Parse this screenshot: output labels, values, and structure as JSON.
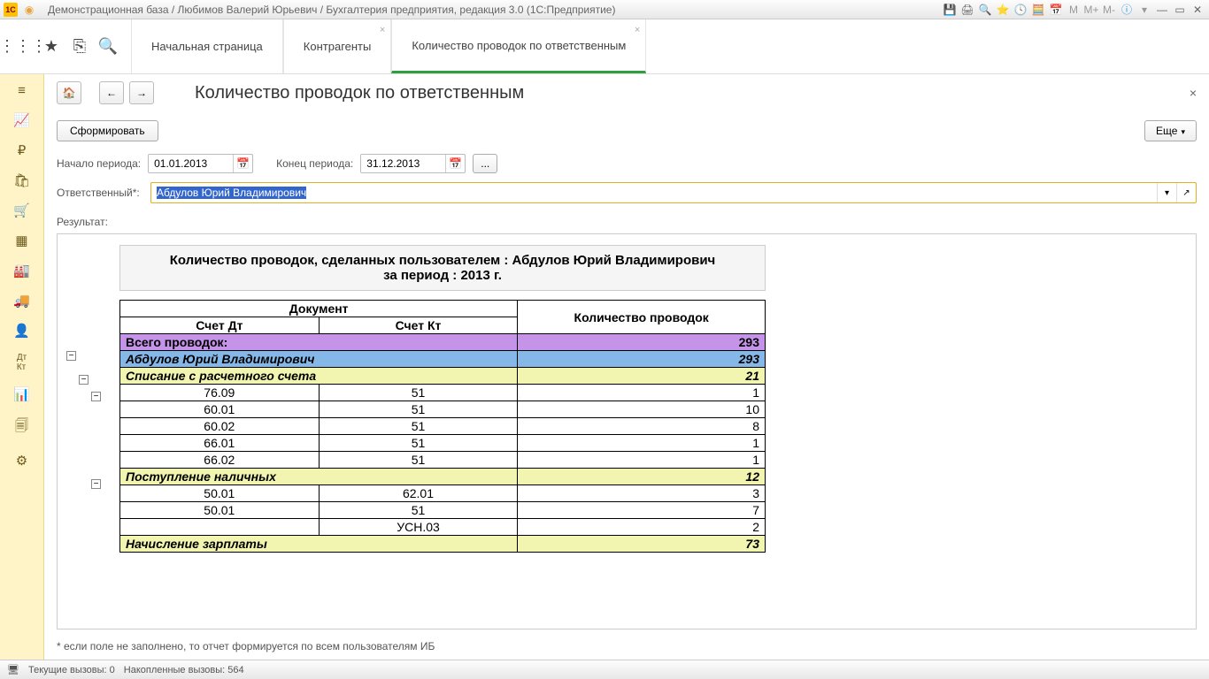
{
  "titlebar": {
    "app_icon": "1C",
    "title": "Демонстрационная база / Любимов Валерий Юрьевич / Бухгалтерия предприятия, редакция 3.0  (1С:Предприятие)"
  },
  "tabs": {
    "home": "Начальная страница",
    "t1": "Контрагенты",
    "t2": "Количество проводок по ответственным"
  },
  "page": {
    "title": "Количество проводок по ответственным",
    "form_btn": "Сформировать",
    "more_btn": "Еще",
    "start_label": "Начало периода:",
    "start_value": "01.01.2013",
    "end_label": "Конец периода:",
    "end_value": "31.12.2013",
    "responsible_label": "Ответственный*:",
    "responsible_value": "Абдулов Юрий Владимирович",
    "result_label": "Результат:",
    "footnote": "* если поле не заполнено, то отчет формируется по всем пользователям ИБ"
  },
  "report": {
    "title_line1": "Количество проводок, сделанных пользователем : Абдулов Юрий Владимирович",
    "title_line2": "за период : 2013 г.",
    "header_doc": "Документ",
    "header_dt": "Счет Дт",
    "header_kt": "Счет Кт",
    "header_count": "Количество проводок",
    "total_label": "Всего проводок:",
    "total_value": "293",
    "user_name": "Абдулов Юрий Владимирович",
    "user_value": "293",
    "groups": [
      {
        "name": "Списание с расчетного счета",
        "value": "21",
        "rows": [
          {
            "dt": "76.09",
            "kt": "51",
            "v": "1"
          },
          {
            "dt": "60.01",
            "kt": "51",
            "v": "10"
          },
          {
            "dt": "60.02",
            "kt": "51",
            "v": "8"
          },
          {
            "dt": "66.01",
            "kt": "51",
            "v": "1"
          },
          {
            "dt": "66.02",
            "kt": "51",
            "v": "1"
          }
        ]
      },
      {
        "name": "Поступление наличных",
        "value": "12",
        "rows": [
          {
            "dt": "50.01",
            "kt": "62.01",
            "v": "3"
          },
          {
            "dt": "50.01",
            "kt": "51",
            "v": "7"
          },
          {
            "dt": "",
            "kt": "УСН.03",
            "v": "2"
          }
        ]
      },
      {
        "name": "Начисление зарплаты",
        "value": "73",
        "rows": []
      }
    ]
  },
  "statusbar": {
    "calls": "Текущие вызовы: 0",
    "accum": "Накопленные вызовы: 564"
  }
}
